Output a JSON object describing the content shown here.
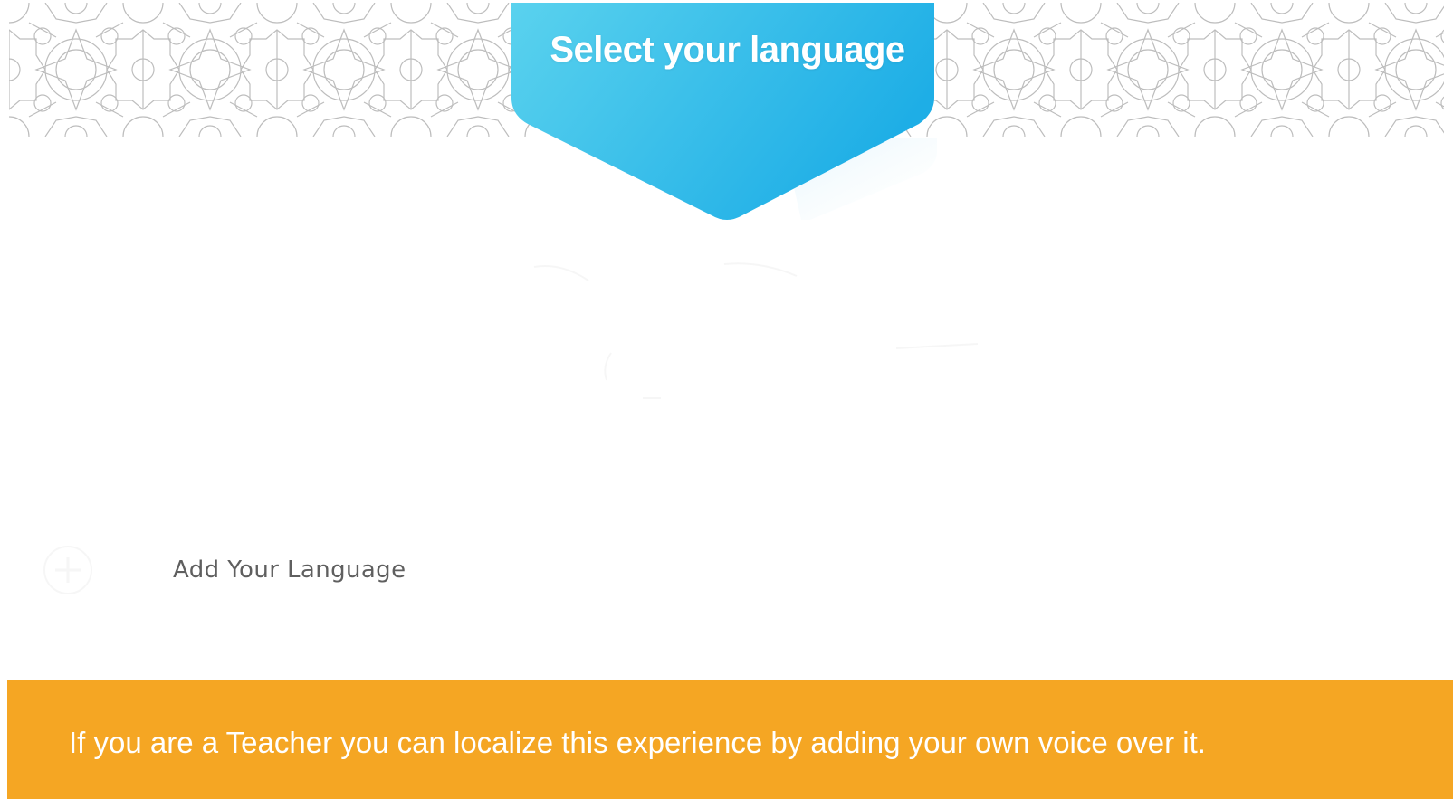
{
  "header": {
    "title": "Select your language",
    "banner_gradient_start": "#5ad2ee",
    "banner_gradient_end": "#1eaee6",
    "pattern_color": "#bdbdbd"
  },
  "language_list": {
    "add_language_label": "Add Your Language",
    "add_language_icon": "plus-icon"
  },
  "footer": {
    "message": "If you are a Teacher you can localize this experience by adding your own voice over it.",
    "background_color": "#f5a623"
  }
}
